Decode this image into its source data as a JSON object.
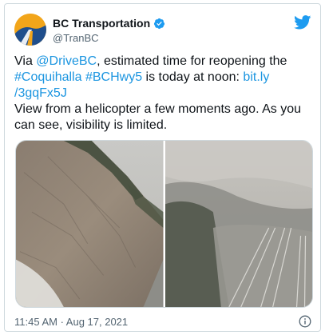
{
  "tweet": {
    "author": {
      "display_name": "BC Transportation",
      "handle": "@TranBC",
      "verified": true
    },
    "text": {
      "prefix": "Via ",
      "mention": "@DriveBC",
      "after_mention": ", estimated time for reopening the",
      "hashtag1": "#Coquihalla",
      "hashtag2": "#BCHwy5",
      "mid": " is today at noon: ",
      "link_part1": "bit.ly",
      "link_part2": "/3gqFx5J",
      "second_paragraph": "View from a helicopter a few moments ago. As you can see, visibility is limited."
    },
    "timestamp": "11:45 AM · Aug 17, 2021"
  },
  "icons": {
    "brand": "twitter-bird-icon",
    "verified": "verified-badge-icon",
    "info": "info-icon"
  },
  "colors": {
    "link": "#1b95e0",
    "twitter_blue": "#1d9bf0",
    "avatar_bg": "#f2a51a"
  }
}
